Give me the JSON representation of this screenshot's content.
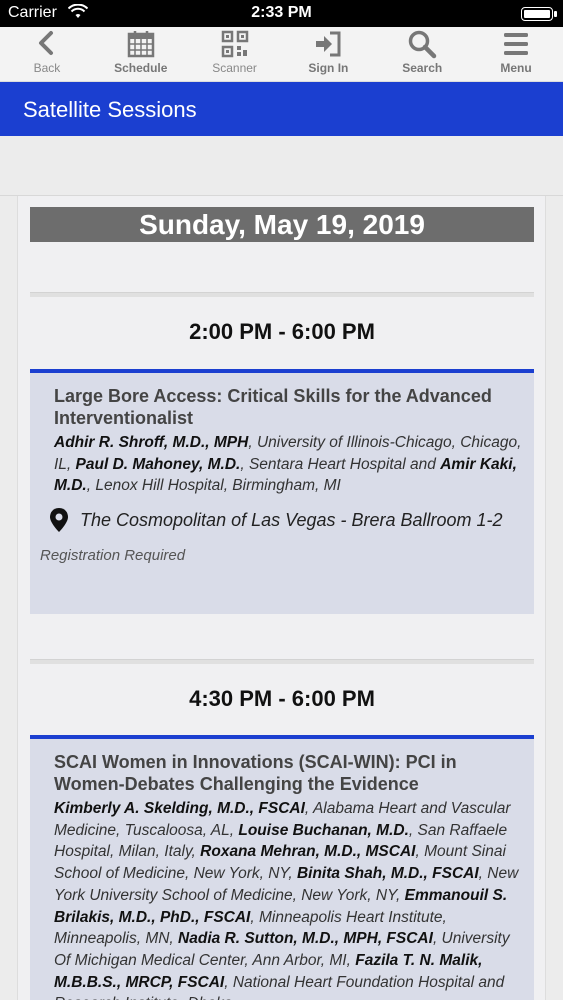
{
  "status_bar": {
    "carrier": "Carrier",
    "time": "2:33 PM"
  },
  "toolbar": {
    "back": "Back",
    "schedule": "Schedule",
    "scanner": "Scanner",
    "sign_in": "Sign In",
    "search": "Search",
    "menu": "Menu"
  },
  "page_title": "Satellite Sessions",
  "day_header": "Sunday, May 19, 2019",
  "sessions": [
    {
      "time": "2:00 PM - 6:00 PM",
      "title": "Large Bore Access: Critical Skills for the Advanced Interventionalist",
      "speakers": [
        {
          "name": "Adhir R. Shroff, M.D., MPH",
          "affiliation": ", University of Illinois-Chicago, Chicago, IL, "
        },
        {
          "name": "Paul D. Mahoney, M.D.",
          "affiliation": ", Sentara Heart Hospital and "
        },
        {
          "name": "Amir Kaki, M.D.",
          "affiliation": ", Lenox Hill Hospital, Birmingham, MI"
        }
      ],
      "location": "The Cosmopolitan of Las Vegas - Brera Ballroom 1-2",
      "registration": "Registration Required"
    },
    {
      "time": "4:30 PM - 6:00 PM",
      "title": "SCAI Women in Innovations (SCAI-WIN): PCI in Women-Debates Challenging the Evidence",
      "speakers": [
        {
          "name": "Kimberly A. Skelding, M.D., FSCAI",
          "affiliation": ", Alabama Heart and Vascular Medicine, Tuscaloosa, AL, "
        },
        {
          "name": "Louise Buchanan, M.D.",
          "affiliation": ", San Raffaele Hospital, Milan, Italy, "
        },
        {
          "name": "Roxana Mehran, M.D., MSCAI",
          "affiliation": ", Mount Sinai School of Medicine, New York, NY, "
        },
        {
          "name": "Binita Shah, M.D., FSCAI",
          "affiliation": ", New York University School of Medicine, New York, NY, "
        },
        {
          "name": "Emmanouil S. Brilakis, M.D., PhD., FSCAI",
          "affiliation": ", Minneapolis Heart Institute, Minneapolis, MN, "
        },
        {
          "name": "Nadia R. Sutton, M.D., MPH, FSCAI",
          "affiliation": ", University Of Michigan Medical Center, Ann Arbor, MI, "
        },
        {
          "name": "Fazila T. N. Malik, M.B.B.S., MRCP, FSCAI",
          "affiliation": ", National Heart Foundation Hospital and Research Institute, Dhaka"
        }
      ]
    }
  ]
}
